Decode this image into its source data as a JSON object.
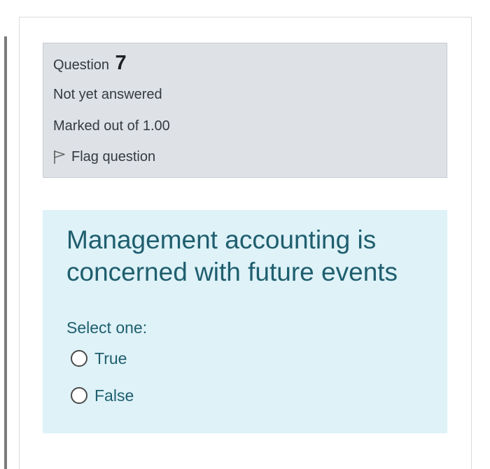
{
  "question_info": {
    "question_label": "Question",
    "question_number": "7",
    "state": "Not yet answered",
    "grade": "Marked out of 1.00",
    "flag_label": "Flag question",
    "flag_icon": "flag-outline-icon"
  },
  "question": {
    "text": "Management accounting is concerned with future events",
    "prompt": "Select one:",
    "options": [
      {
        "label": "True",
        "selected": false
      },
      {
        "label": "False",
        "selected": false
      }
    ]
  },
  "colors": {
    "info_background": "#dee2e6",
    "question_background": "#def2f8",
    "question_text": "#1f5e6e"
  }
}
